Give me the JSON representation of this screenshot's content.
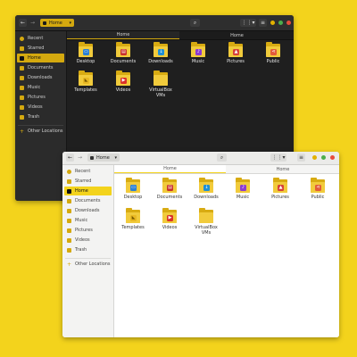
{
  "colors": {
    "background": "#f3d31c",
    "accent_dark": "#d4a90f",
    "accent_light": "#f3d31c",
    "close": "#e74c3c",
    "maximize": "#4cae4c",
    "minimize": "#e2b100"
  },
  "dark_window": {
    "path_label": "Home",
    "tabs": [
      "Home",
      "Home"
    ],
    "sidebar": [
      "Recent",
      "Starred",
      "Home",
      "Documents",
      "Downloads",
      "Music",
      "Pictures",
      "Videos",
      "Trash",
      "Other Locations"
    ],
    "folders": [
      {
        "label": "Desktop",
        "emblem": "desktop-icon"
      },
      {
        "label": "Documents",
        "emblem": "document-icon"
      },
      {
        "label": "Downloads",
        "emblem": "download-icon"
      },
      {
        "label": "Music",
        "emblem": "music-icon"
      },
      {
        "label": "Pictures",
        "emblem": "pictures-icon"
      },
      {
        "label": "Public",
        "emblem": "share-icon"
      },
      {
        "label": "Templates",
        "emblem": "template-icon"
      },
      {
        "label": "Videos",
        "emblem": "video-icon"
      },
      {
        "label": "VirtualBox VMs",
        "emblem": "none"
      }
    ]
  },
  "light_window": {
    "path_label": "Home",
    "tabs": [
      "Home",
      "Home"
    ],
    "sidebar": [
      "Recent",
      "Starred",
      "Home",
      "Documents",
      "Downloads",
      "Music",
      "Pictures",
      "Videos",
      "Trash",
      "Other Locations"
    ],
    "folders": [
      {
        "label": "Desktop",
        "emblem": "desktop-icon"
      },
      {
        "label": "Documents",
        "emblem": "document-icon"
      },
      {
        "label": "Downloads",
        "emblem": "download-icon"
      },
      {
        "label": "Music",
        "emblem": "music-icon"
      },
      {
        "label": "Pictures",
        "emblem": "pictures-icon"
      },
      {
        "label": "Public",
        "emblem": "share-icon"
      },
      {
        "label": "Templates",
        "emblem": "template-icon"
      },
      {
        "label": "Videos",
        "emblem": "video-icon"
      },
      {
        "label": "VirtualBox VMs",
        "emblem": "none"
      }
    ]
  }
}
